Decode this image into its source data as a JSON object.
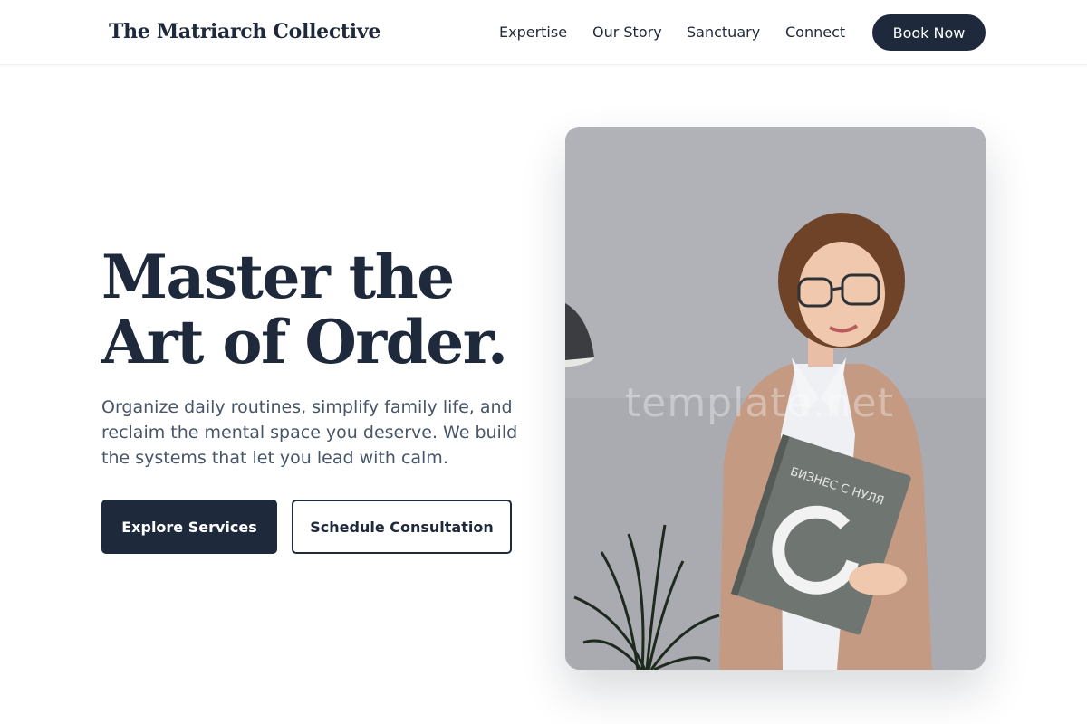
{
  "header": {
    "brand": "The Matriarch Collective",
    "nav": [
      "Expertise",
      "Our Story",
      "Sanctuary",
      "Connect"
    ],
    "cta": "Book Now"
  },
  "hero": {
    "title_line1": "Master the",
    "title_line2": "Art of Order.",
    "subtitle": "Organize daily routines, simplify family life, and reclaim the mental space you deserve. We build the systems that let you lead with calm.",
    "primary_button": "Explore Services",
    "secondary_button": "Schedule Consultation",
    "image": {
      "watermark": "template.net",
      "book_title": "БИЗНЕС С НУЛЯ"
    }
  },
  "colors": {
    "navy": "#1e293b",
    "text_muted": "#475569",
    "background": "#ffffff"
  }
}
